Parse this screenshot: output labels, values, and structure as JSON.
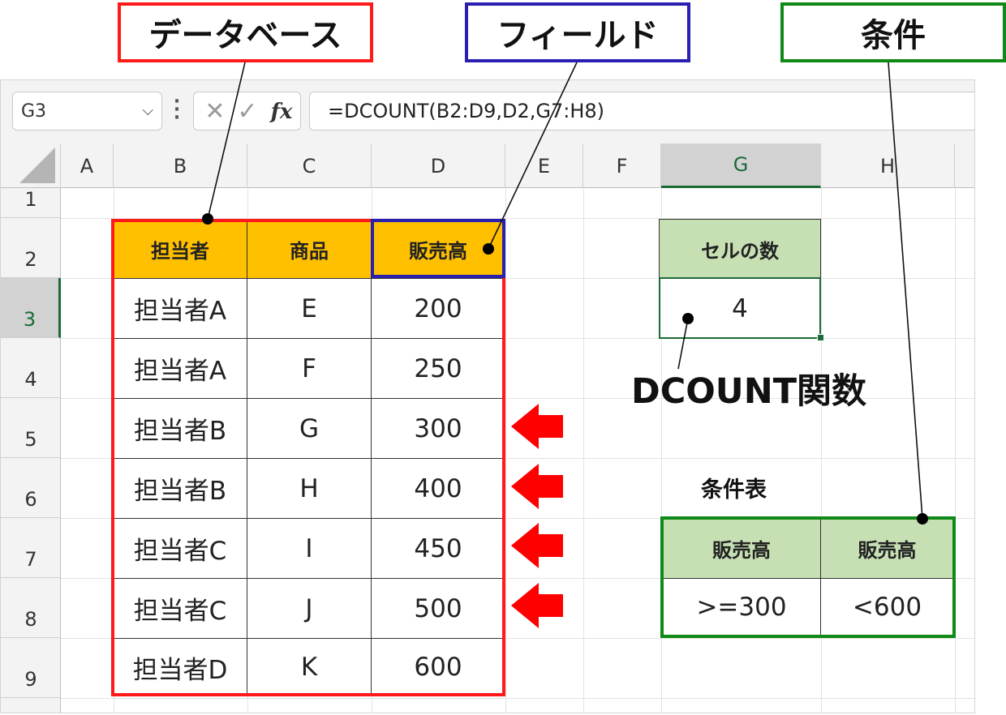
{
  "callouts": {
    "database": "データベース",
    "field": "フィールド",
    "criteria": "条件"
  },
  "toolbar": {
    "name_box": "G3",
    "formula": "=DCOUNT(B2:D9,D2,G7:H8)",
    "fx_label": "fx"
  },
  "columns": [
    "A",
    "B",
    "C",
    "D",
    "E",
    "F",
    "G",
    "H"
  ],
  "rows": [
    "1",
    "2",
    "3",
    "4",
    "5",
    "6",
    "7",
    "8",
    "9"
  ],
  "selected": {
    "column": "G",
    "row": "3"
  },
  "database_table": {
    "headers": [
      "担当者",
      "商品",
      "販売高"
    ],
    "rows": [
      [
        "担当者A",
        "E",
        "200"
      ],
      [
        "担当者A",
        "F",
        "250"
      ],
      [
        "担当者B",
        "G",
        "300"
      ],
      [
        "担当者B",
        "H",
        "400"
      ],
      [
        "担当者C",
        "I",
        "450"
      ],
      [
        "担当者C",
        "J",
        "500"
      ],
      [
        "担当者D",
        "K",
        "600"
      ]
    ]
  },
  "result": {
    "header": "セルの数",
    "value": "4",
    "function_label": "DCOUNT関数"
  },
  "criteria_table": {
    "title": "条件表",
    "headers": [
      "販売高",
      "販売高"
    ],
    "values": [
      ">=300",
      "<600"
    ]
  },
  "colors": {
    "header_fill": "#ffc000",
    "criteria_fill": "#c6e0b4",
    "database_frame": "#ff1a1a",
    "field_frame": "#2a1fb0",
    "criteria_frame": "#0f8a16",
    "arrow": "#ff0000"
  }
}
